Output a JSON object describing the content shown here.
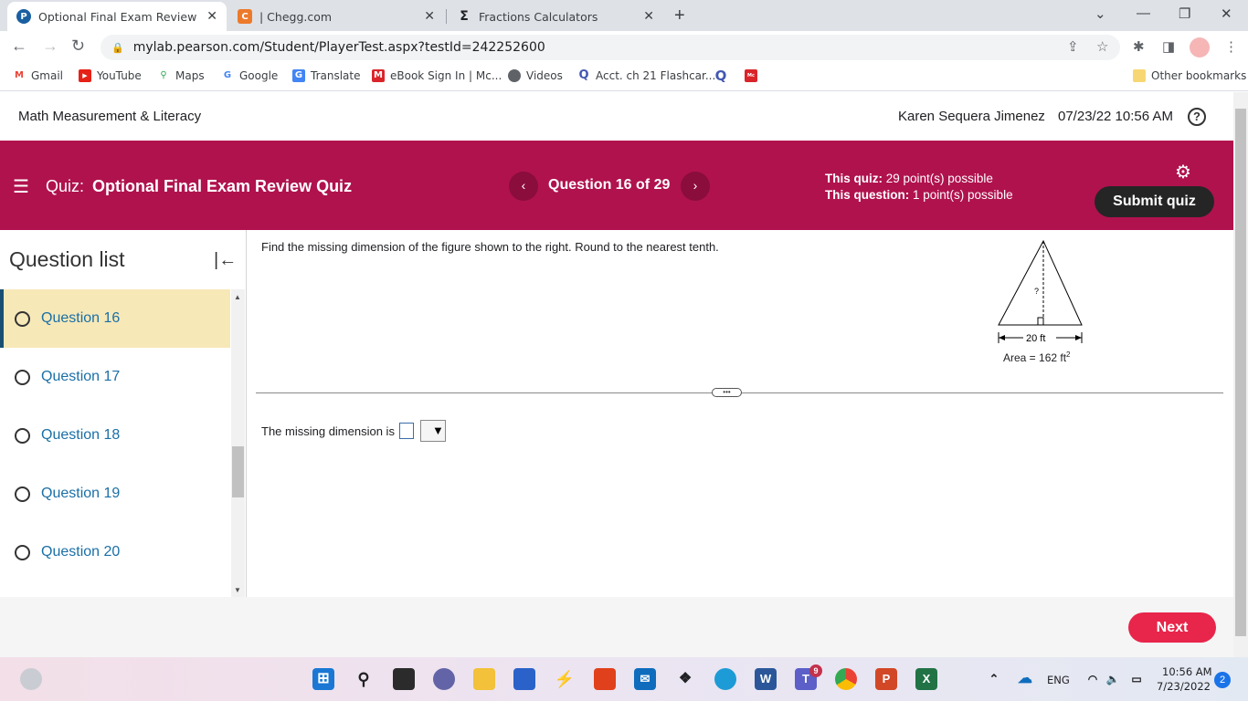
{
  "browser": {
    "tabs": [
      {
        "title": "Optional Final Exam Review Quiz",
        "favicon": "P"
      },
      {
        "title": "| Chegg.com",
        "favicon": "C"
      },
      {
        "title": "Fractions Calculators",
        "favicon": "Σ"
      }
    ],
    "url": "mylab.pearson.com/Student/PlayerTest.aspx?testId=242252600",
    "bookmarks": [
      "Gmail",
      "YouTube",
      "Maps",
      "Google",
      "Translate",
      "eBook Sign In | Mc...",
      "Videos",
      "Acct. ch 21 Flashcar..."
    ],
    "other_bookmarks": "Other bookmarks"
  },
  "header": {
    "site_title": "Math Measurement & Literacy",
    "user_name": "Karen Sequera Jimenez",
    "datetime": "07/23/22 10:56 AM"
  },
  "quizbar": {
    "quiz_label": "Quiz:",
    "quiz_title": "Optional Final Exam Review Quiz",
    "question_counter": "Question 16 of 29",
    "quiz_points_label": "This quiz:",
    "quiz_points_value": "29 point(s) possible",
    "question_points_label": "This question:",
    "question_points_value": "1 point(s) possible",
    "submit_label": "Submit quiz"
  },
  "question_list": {
    "title": "Question list",
    "items": [
      {
        "label": "Question 16",
        "current": true
      },
      {
        "label": "Question 17",
        "current": false
      },
      {
        "label": "Question 18",
        "current": false
      },
      {
        "label": "Question 19",
        "current": false
      },
      {
        "label": "Question 20",
        "current": false
      }
    ]
  },
  "question": {
    "prompt": "Find the missing dimension of the figure shown to the right. Round to the nearest tenth.",
    "figure": {
      "height_label": "?",
      "base_label": "20 ft",
      "area_label": "Area = 162 ft",
      "area_exponent": "2"
    },
    "answer_prefix": "The missing dimension is",
    "answer_value": "",
    "unit_select_value": ""
  },
  "footer": {
    "next_label": "Next"
  },
  "taskbar": {
    "language": "ENG",
    "time": "10:56 AM",
    "date": "7/23/2022",
    "notifications": "2",
    "teams_badge": "9"
  },
  "colors": {
    "brand": "#b0124e",
    "current_question_bg": "#f7e8b8",
    "link": "#1a6fa6",
    "next_button": "#e8254a",
    "submit_button": "#252525"
  }
}
